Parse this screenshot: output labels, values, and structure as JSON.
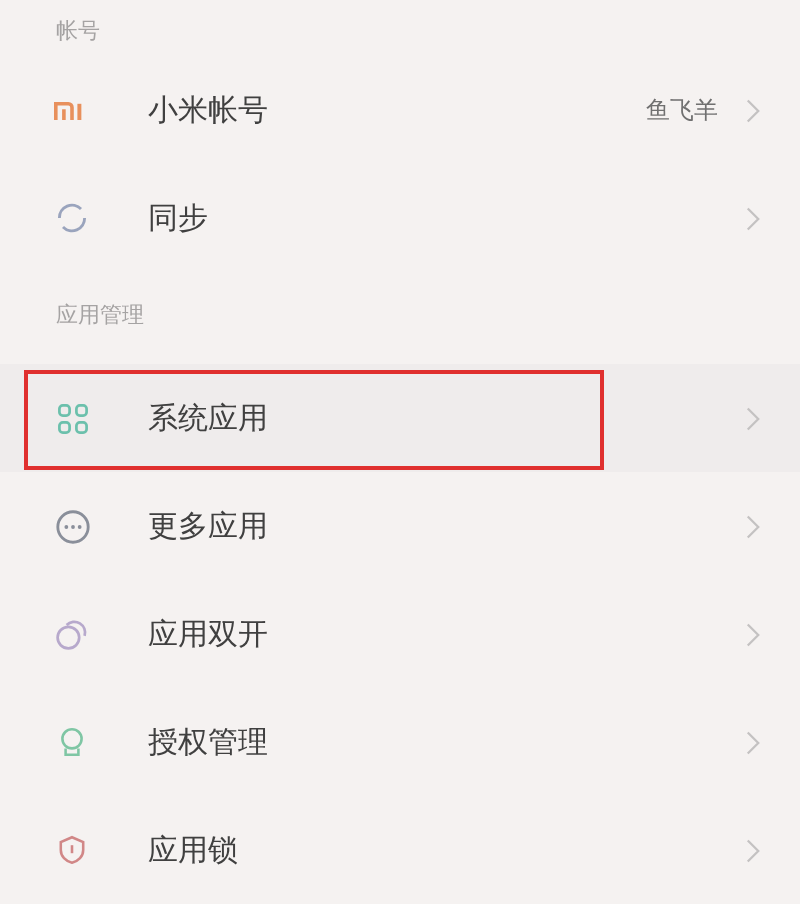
{
  "sections": [
    {
      "header": "帐号",
      "items": [
        {
          "kind": "logo",
          "label": "小米帐号",
          "value": "鱼飞羊",
          "highlighted": false
        },
        {
          "kind": "sync",
          "label": "同步",
          "highlighted": false
        }
      ]
    },
    {
      "header": "应用管理",
      "items": [
        {
          "kind": "grid",
          "label": "系统应用",
          "highlighted": true
        },
        {
          "kind": "more",
          "label": "更多应用",
          "highlighted": false
        },
        {
          "kind": "dual",
          "label": "应用双开",
          "highlighted": false
        },
        {
          "kind": "permission",
          "label": "授权管理",
          "highlighted": false
        },
        {
          "kind": "lock",
          "label": "应用锁",
          "highlighted": false
        }
      ]
    }
  ]
}
